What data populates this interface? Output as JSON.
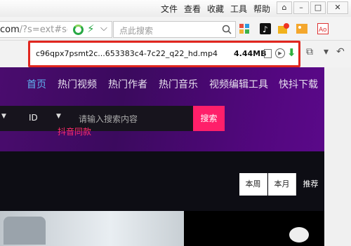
{
  "menu": {
    "items": [
      "文件",
      "查看",
      "收藏",
      "工具",
      "帮助"
    ]
  },
  "address": {
    "prefix": "com",
    "path": "/?s=ext#sear"
  },
  "search": {
    "placeholder": "点此搜索"
  },
  "download": {
    "filename": "c96qpx7psmt2c...653383c4-7c22_q22_hd.mp4",
    "size": "4.44MB"
  },
  "site": {
    "nav": [
      "首页",
      "热门视频",
      "热门作者",
      "热门音乐",
      "视频编辑工具",
      "快抖下载"
    ],
    "search_type": "ID",
    "search_placeholder": "请输入搜索内容",
    "search_button": "搜索",
    "hint": "抖音同款",
    "tabs": [
      "本周",
      "本月",
      "推荐"
    ]
  },
  "colors": {
    "accent_pink": "#ff1f6a",
    "nav_active": "#5fb3ef",
    "download_border": "#e0261f"
  }
}
